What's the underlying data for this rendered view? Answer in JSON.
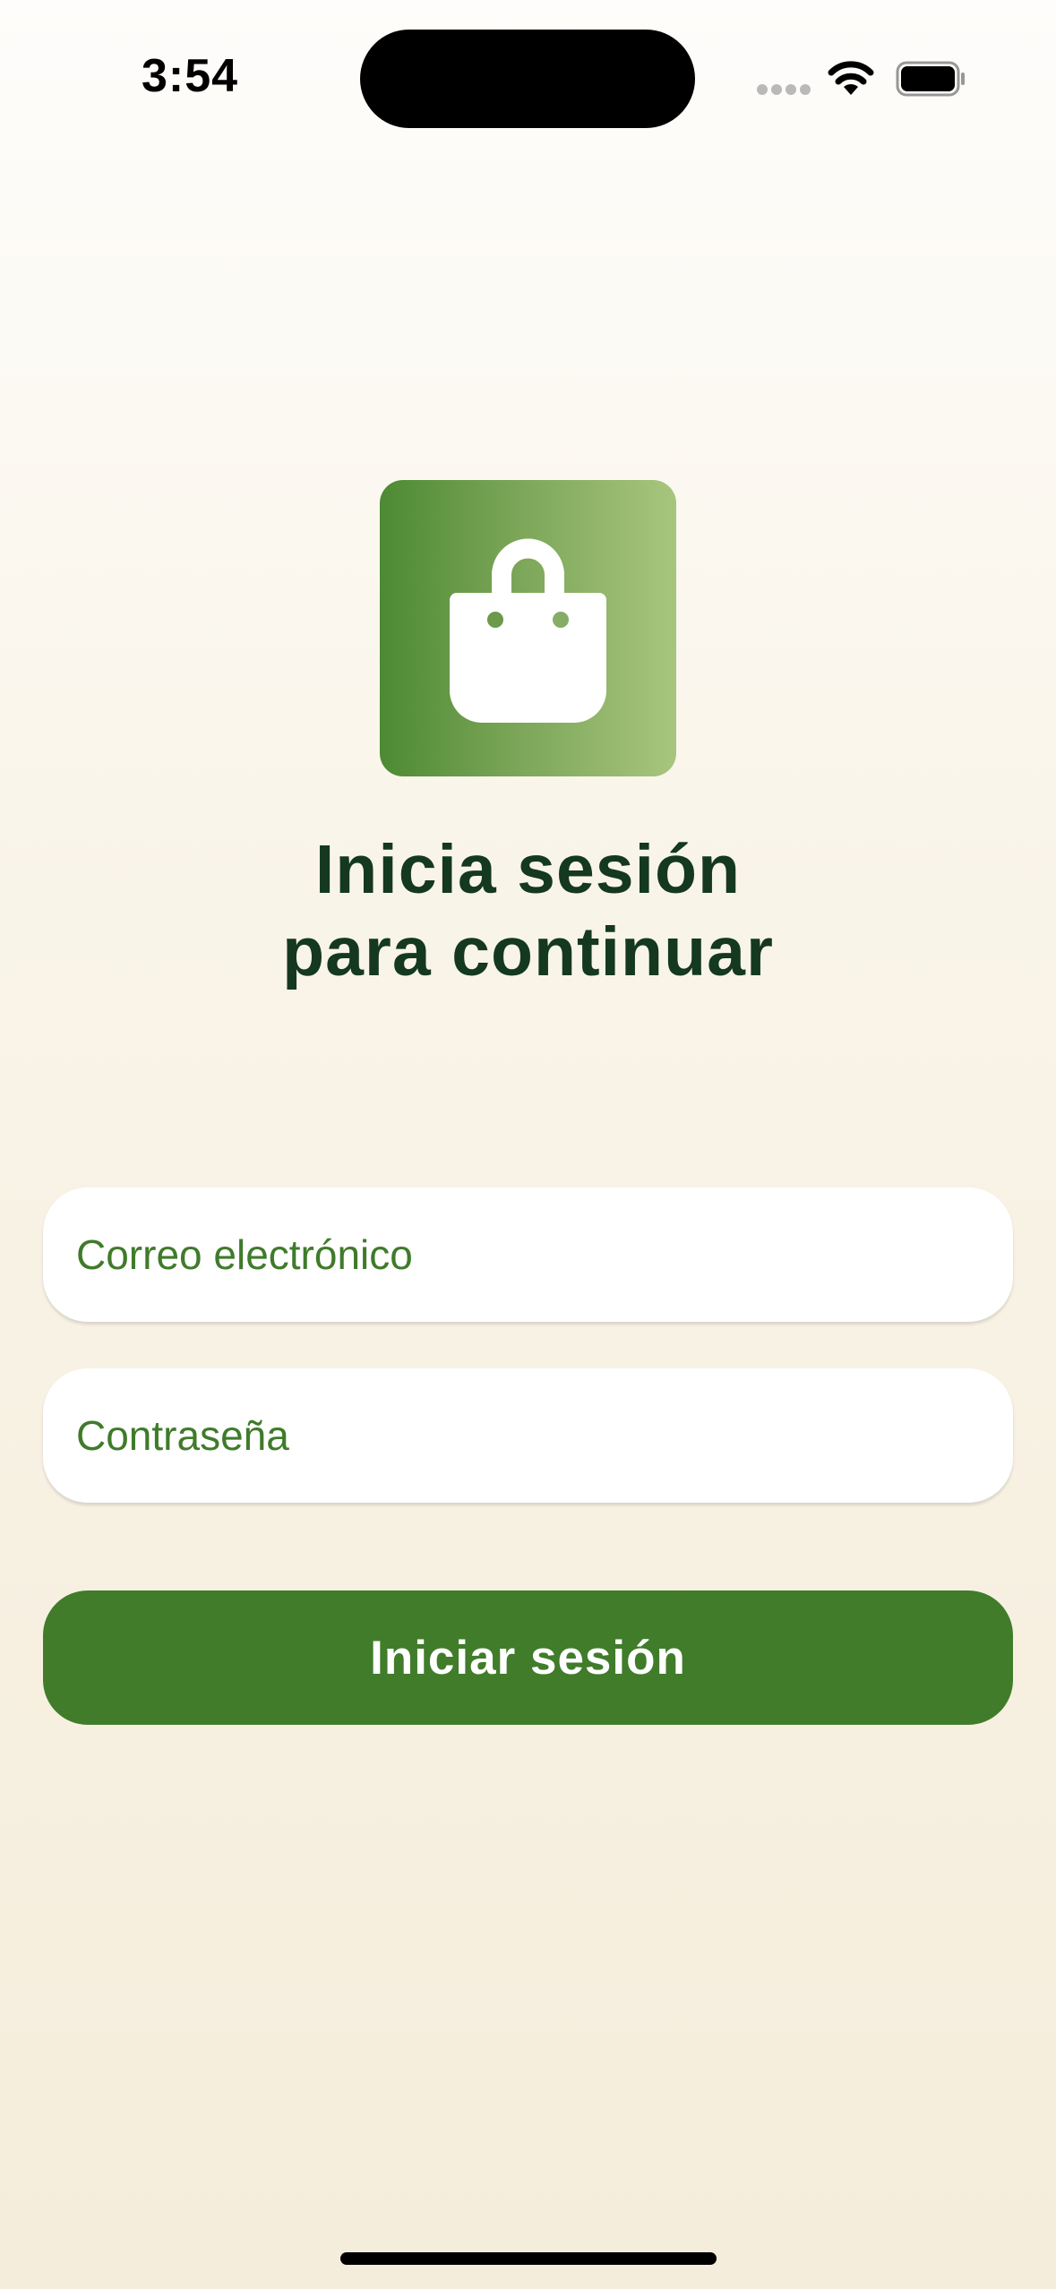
{
  "status_bar": {
    "time": "3:54"
  },
  "logo": {
    "icon": "shopping-bag-icon",
    "gradient_start": "#4d8a33",
    "gradient_end": "#a8c57e"
  },
  "title": {
    "line1": "Inicia sesión",
    "line2": "para continuar"
  },
  "form": {
    "email_placeholder": "Correo electrónico",
    "email_value": "",
    "password_placeholder": "Contraseña",
    "password_value": ""
  },
  "login_button": {
    "label": "Iniciar sesión"
  },
  "colors": {
    "accent": "#407c2a",
    "title_text": "#143820",
    "placeholder_text": "#3f7b2a"
  }
}
